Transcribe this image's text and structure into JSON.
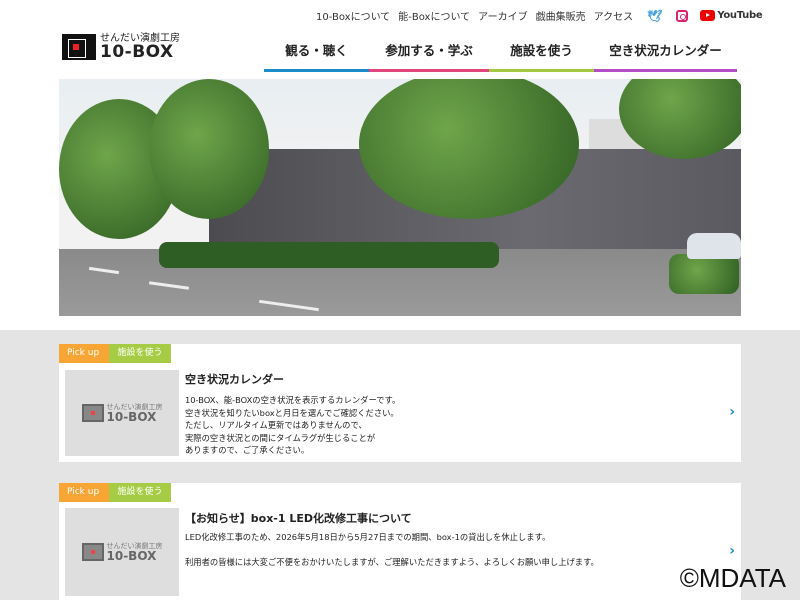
{
  "header": {
    "top_links": [
      "10-Boxについて",
      "能-Boxについて",
      "アーカイブ",
      "戯曲集販売",
      "アクセス"
    ],
    "youtube_label": "YouTube",
    "logo_sub": "せんだい演劇工房",
    "logo_main": "10-BOX",
    "main_nav": [
      {
        "label": "観る・聴く",
        "color": "#1a8ac9"
      },
      {
        "label": "参加する・学ぶ",
        "color": "#e0457b"
      },
      {
        "label": "施設を使う",
        "color": "#a6c840"
      },
      {
        "label": "空き状況カレンダー",
        "color": "#b44cc6"
      }
    ]
  },
  "cards": [
    {
      "tag1": "Pick up",
      "tag2": "施設を使う",
      "title": "空き状況カレンダー",
      "body": [
        "10-BOX、能-BOXの空き状況を表示するカレンダーです。",
        "空き状況を知りたいboxと月日を選んでご確認ください。",
        "ただし、リアルタイム更新ではありませんので、",
        "実際の空き状況との間にタイムラグが生じることが",
        "ありますので、ご了承ください。"
      ]
    },
    {
      "tag1": "Pick up",
      "tag2": "施設を使う",
      "title": "【お知らせ】box-1 LED化改修工事について",
      "body": [
        "LED化改修工事のため、2026年5月18日から5月27日までの期間、box-1の貸出しを休止します。",
        "",
        "利用者の皆様には大変ご不便をおかけいたしますが、ご理解いただきますよう、よろしくお願い申し上げます。"
      ]
    }
  ],
  "watermark": "©MDATA"
}
